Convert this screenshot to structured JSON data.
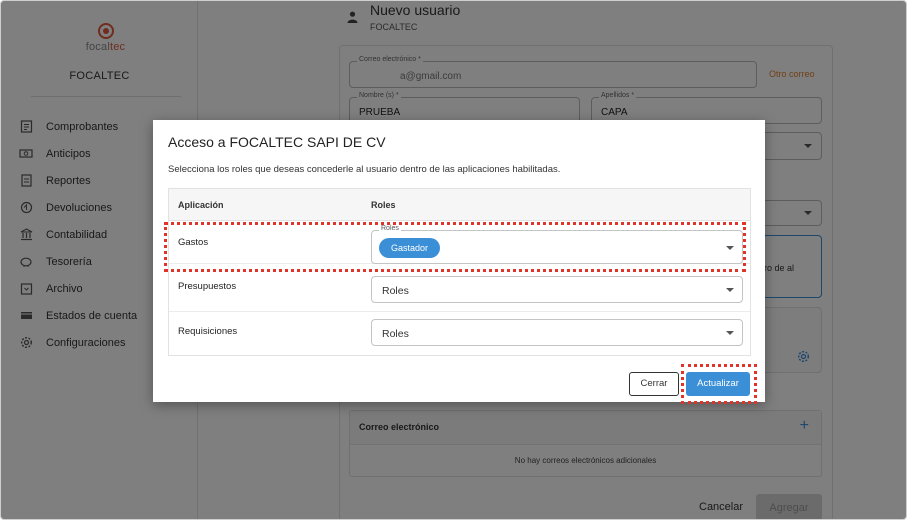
{
  "sidebar": {
    "logo_text_a": "focal",
    "logo_text_b": "tec",
    "company": "FOCALTEC",
    "items": [
      {
        "label": "Comprobantes",
        "icon": "receipt-icon"
      },
      {
        "label": "Anticipos",
        "icon": "money-icon"
      },
      {
        "label": "Reportes",
        "icon": "report-icon"
      },
      {
        "label": "Devoluciones",
        "icon": "refund-icon"
      },
      {
        "label": "Contabilidad",
        "icon": "bank-icon"
      },
      {
        "label": "Tesorería",
        "icon": "piggy-bank-icon"
      },
      {
        "label": "Archivo",
        "icon": "archive-icon"
      },
      {
        "label": "Estados de cuenta",
        "icon": "statement-icon"
      },
      {
        "label": "Configuraciones",
        "icon": "gear-icon"
      }
    ]
  },
  "header": {
    "title": "Nuevo usuario",
    "subtitle": "FOCALTEC"
  },
  "form": {
    "email_label": "Correo electrónico *",
    "email_value": "a@gmail.com",
    "otro_correo": "Otro correo",
    "nombre_label": "Nombre (s) *",
    "nombre_value": "PRUEBA",
    "apellidos_label": "Apellidos *",
    "apellidos_value": "CAPA",
    "partial_text": "ro de al",
    "mail_section_title": "Correo electrónico",
    "mail_add": "+",
    "mail_empty": "No hay correos electrónicos adicionales",
    "cancel_label": "Cancelar",
    "add_label": "Agregar"
  },
  "modal": {
    "title": "Acceso a FOCALTEC SAPI DE CV",
    "description": "Selecciona los roles que deseas concederle al usuario dentro de las aplicaciones habilitadas.",
    "col_app": "Aplicación",
    "col_roles": "Roles",
    "rows": [
      {
        "app": "Gastos",
        "select_label": "Roles",
        "chip": "Gastador"
      },
      {
        "app": "Presupuestos",
        "placeholder": "Roles"
      },
      {
        "app": "Requisiciones",
        "placeholder": "Roles"
      }
    ],
    "close_label": "Cerrar",
    "update_label": "Actualizar"
  },
  "colors": {
    "accent": "#3b8fd6",
    "brand": "#e0583d",
    "highlight": "#e0342a",
    "link": "#e0822d"
  }
}
